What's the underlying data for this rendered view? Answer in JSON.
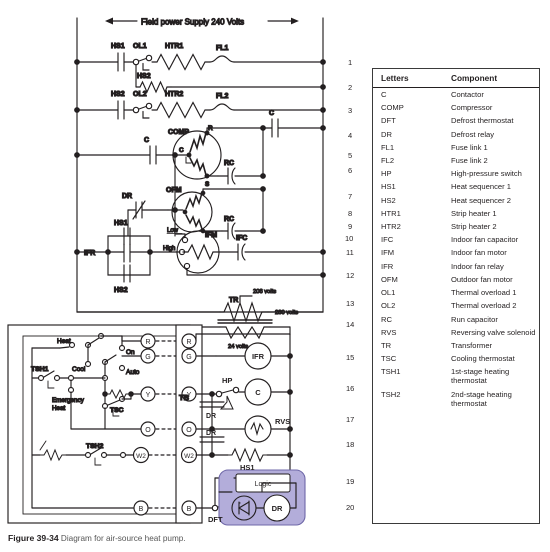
{
  "figure": {
    "number": "Figure 39-34",
    "caption": "Diagram for air-source heat pump."
  },
  "power": {
    "supply_label": "Field power Supply 240 Volts"
  },
  "transformer": {
    "name": "TR",
    "tap_208": "208 volts",
    "tap_230": "230 volts",
    "secondary": "24 volts"
  },
  "rung_numbers": [
    "1",
    "2",
    "3",
    "4",
    "5",
    "6",
    "7",
    "8",
    "9",
    "10",
    "11",
    "12",
    "13",
    "14",
    "15",
    "16",
    "17",
    "18",
    "19",
    "20"
  ],
  "power_circuit_labels": {
    "hs1_a": "HS1",
    "ol1": "OL1",
    "htr1": "HTR1",
    "fl1": "FL1",
    "hs2_a": "HS2",
    "hs2_b": "HS2",
    "ol2": "OL2",
    "htr2": "HTR2",
    "fl2": "FL2",
    "comp": "COMP",
    "comp_r": "R",
    "comp_c": "C",
    "comp_s": "S",
    "cap_c_left": "C",
    "cap_c_right": "C",
    "rc_comp": "RC",
    "ofm": "OFM",
    "dr": "DR",
    "rc_ofm": "RC",
    "hs1_b": "HS1",
    "hs2_c": "HS2",
    "ifr": "IFR",
    "ifm": "IFM",
    "ifm_low": "Low",
    "ifm_high": "High",
    "ifc": "IFC"
  },
  "thermostat": {
    "heat": "Heat",
    "cool": "Cool",
    "on": "On",
    "auto": "Auto",
    "tsh1": "TSH1",
    "tsh2": "TSH2",
    "tsc": "TSC",
    "emergency_heat_line1": "Emergency",
    "emergency_heat_line2": "Heat",
    "terminals": [
      "R",
      "G",
      "Y",
      "O",
      "W2",
      "B"
    ]
  },
  "terminal_block": {
    "label": "TB",
    "terminals": [
      "R",
      "G",
      "Y",
      "O",
      "W2",
      "B"
    ]
  },
  "control_circuit": {
    "ifr": "IFR",
    "hp": "HP",
    "contactor": "C",
    "rvs": "RVS",
    "hs1": "HS1",
    "dr_cap_1": "DR",
    "dr_cap_2": "DR",
    "dft": "DFT",
    "logic": "Logic",
    "dr_coil": "DR"
  },
  "legend": {
    "header_letters": "Letters",
    "header_component": "Component",
    "rows": [
      {
        "letters": "C",
        "component": "Contactor"
      },
      {
        "letters": "COMP",
        "component": "Compressor"
      },
      {
        "letters": "DFT",
        "component": "Defrost thermostat"
      },
      {
        "letters": "DR",
        "component": "Defrost relay"
      },
      {
        "letters": "FL1",
        "component": "Fuse link 1"
      },
      {
        "letters": "FL2",
        "component": "Fuse link 2"
      },
      {
        "letters": "HP",
        "component": "High-pressure switch"
      },
      {
        "letters": "HS1",
        "component": "Heat sequencer 1"
      },
      {
        "letters": "HS2",
        "component": "Heat sequencer 2"
      },
      {
        "letters": "HTR1",
        "component": "Strip heater 1"
      },
      {
        "letters": "HTR2",
        "component": "Strip heater 2"
      },
      {
        "letters": "IFC",
        "component": "Indoor fan capacitor"
      },
      {
        "letters": "IFM",
        "component": "Indoor fan motor"
      },
      {
        "letters": "IFR",
        "component": "Indoor fan relay"
      },
      {
        "letters": "OFM",
        "component": "Outdoor fan motor"
      },
      {
        "letters": "OL1",
        "component": "Thermal overload 1"
      },
      {
        "letters": "OL2",
        "component": "Thermal overload 2"
      },
      {
        "letters": "RC",
        "component": "Run capacitor"
      },
      {
        "letters": "RVS",
        "component": "Reversing valve solenoid"
      },
      {
        "letters": "TR",
        "component": "Transformer"
      },
      {
        "letters": "TSC",
        "component": "Cooling thermostat"
      },
      {
        "letters": "TSH1",
        "component": "1st-stage heating thermostat"
      },
      {
        "letters": "TSH2",
        "component": "2nd-stage heating thermostat"
      }
    ]
  },
  "colors": {
    "line": "#231f20",
    "defrost_box": "#b3adda",
    "defrost_box_stroke": "#6f68a8"
  }
}
